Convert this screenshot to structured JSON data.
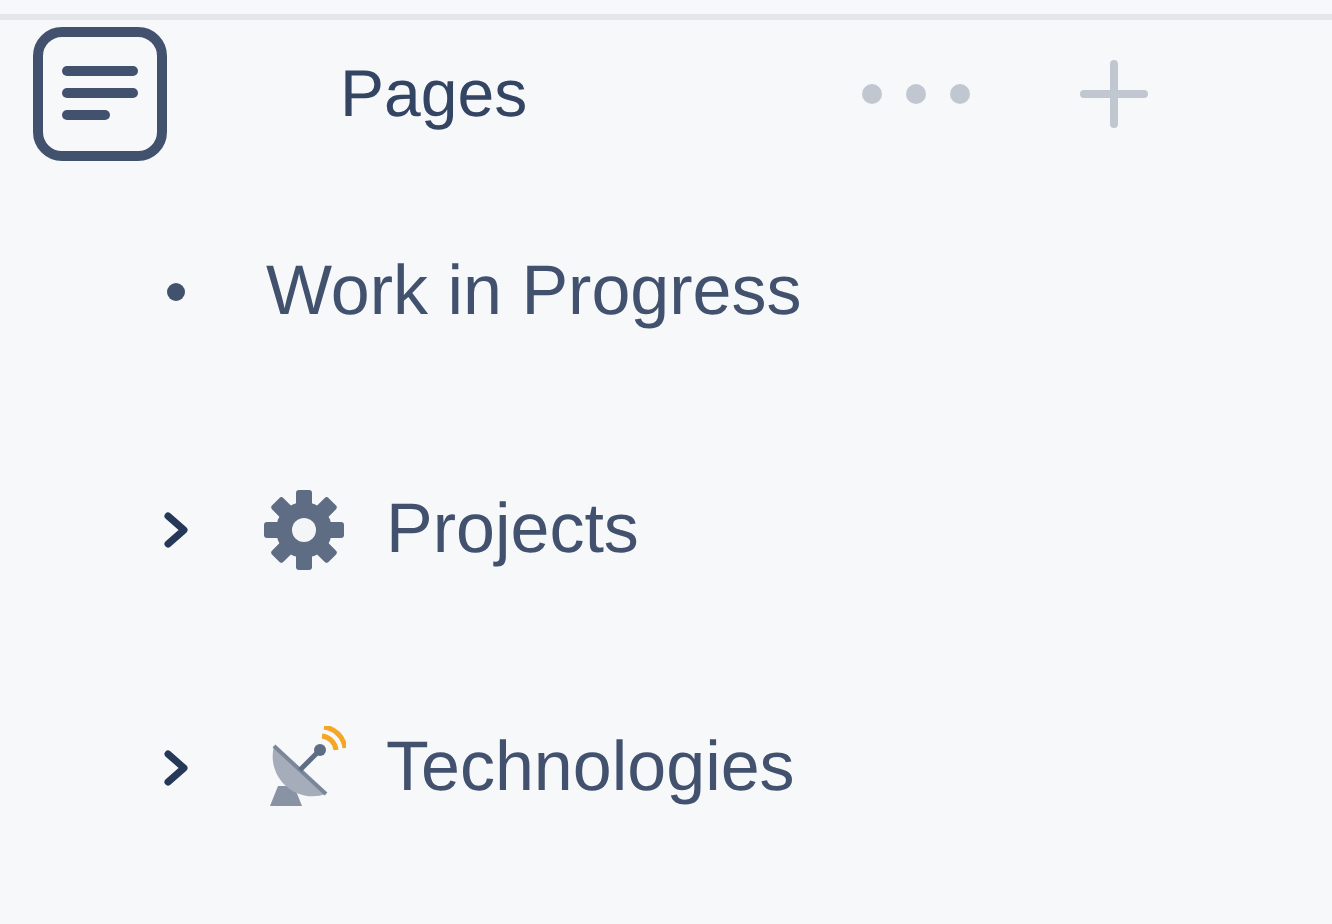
{
  "header": {
    "title": "Pages"
  },
  "items": [
    {
      "label": "Work in Progress",
      "kind": "leaf"
    },
    {
      "label": "Projects",
      "kind": "folder",
      "expanded": false
    },
    {
      "label": "Technologies",
      "kind": "folder",
      "expanded": false
    }
  ]
}
